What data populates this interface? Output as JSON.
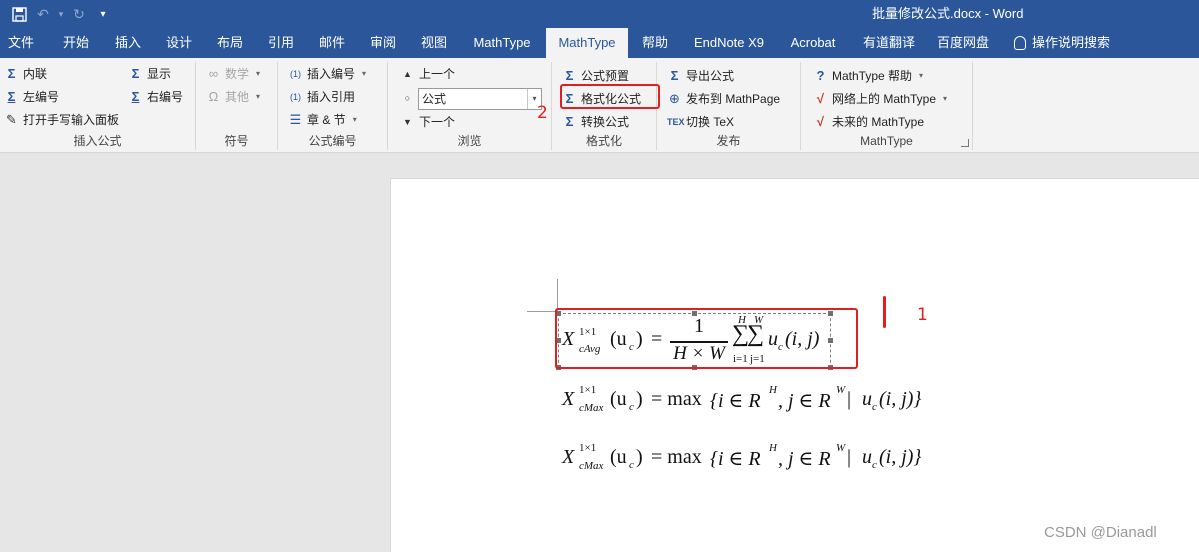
{
  "title_bar": {
    "doc_title": "批量修改公式.docx  -  Word",
    "qat_icons": [
      "save-icon",
      "undo-icon",
      "redo-icon",
      "customize-icon"
    ]
  },
  "tabs": [
    {
      "label": "文件"
    },
    {
      "label": "开始"
    },
    {
      "label": "插入"
    },
    {
      "label": "设计"
    },
    {
      "label": "布局"
    },
    {
      "label": "引用"
    },
    {
      "label": "邮件"
    },
    {
      "label": "审阅"
    },
    {
      "label": "视图"
    },
    {
      "label": "MathType"
    },
    {
      "label": "MathType",
      "active": true
    },
    {
      "label": "帮助"
    },
    {
      "label": "EndNote X9"
    },
    {
      "label": "Acrobat"
    },
    {
      "label": "有道翻译"
    },
    {
      "label": "百度网盘"
    }
  ],
  "tell_me": "操作说明搜索",
  "ribbon": {
    "insert_formula": {
      "label": "插入公式",
      "inline": "内联",
      "display": "显示",
      "left_number": "左编号",
      "right_number": "右编号",
      "handwriting": "打开手写输入面板"
    },
    "symbols": {
      "label": "符号",
      "math": "数学",
      "other": "其他"
    },
    "formula_number": {
      "label": "公式编号",
      "insert_number": "插入编号",
      "insert_reference": "插入引用",
      "chapter_section": "章 & 节"
    },
    "browse": {
      "label": "浏览",
      "previous": "上一个",
      "next": "下一个",
      "combo_value": "公式"
    },
    "format": {
      "label": "格式化",
      "preset": "公式预置",
      "format_equations": "格式化公式",
      "convert": "转换公式"
    },
    "publish": {
      "label": "发布",
      "export": "导出公式",
      "publish_mathpage": "发布到 MathPage",
      "toggle_tex": "切换 TeX"
    },
    "mathtype": {
      "label": "MathType",
      "help": "MathType 帮助",
      "on_web": "网络上的 MathType",
      "future": "未来的 MathType"
    }
  },
  "annotations": {
    "mark1": "1",
    "mark2": "2"
  },
  "equations": {
    "eq1": {
      "X": "X",
      "sup": "1×1",
      "sub": "cAvg",
      "arg": "(u",
      "argsub": "c",
      "argclose": ")",
      "eq": "=",
      "num": "1",
      "den": "H × W",
      "sig1_top": "H",
      "sig1_bot": "i=1",
      "sig2_top": "W",
      "sig2_bot": "j=1",
      "sigma": "∑",
      "u": "u",
      "usub": "c",
      "tail": "(i, j)"
    },
    "eq2": {
      "X": "X",
      "sup": "1×1",
      "sub": "cMax",
      "arg": "(u",
      "argsub": "c",
      "argclose": ")",
      "eq": "= max",
      "body1": "{i ∈ R",
      "supH": "H",
      "body2": ", j ∈ R",
      "supW": "W",
      "bar": "|",
      "u": "u",
      "usub": "c",
      "tail": "(i, j)}"
    },
    "eq3": {
      "X": "X",
      "sup": "1×1",
      "sub": "cMax",
      "arg": "(u",
      "argsub": "c",
      "argclose": ")",
      "eq": "= max",
      "body1": "{i ∈ R",
      "supH": "H",
      "body2": ", j ∈ R",
      "supW": "W",
      "bar": "|",
      "u": "u",
      "usub": "c",
      "tail": "(i, j)}"
    }
  },
  "watermark": "CSDN @Dianadl",
  "colors": {
    "word_blue": "#2b579a",
    "annotation_red": "#e02020"
  }
}
